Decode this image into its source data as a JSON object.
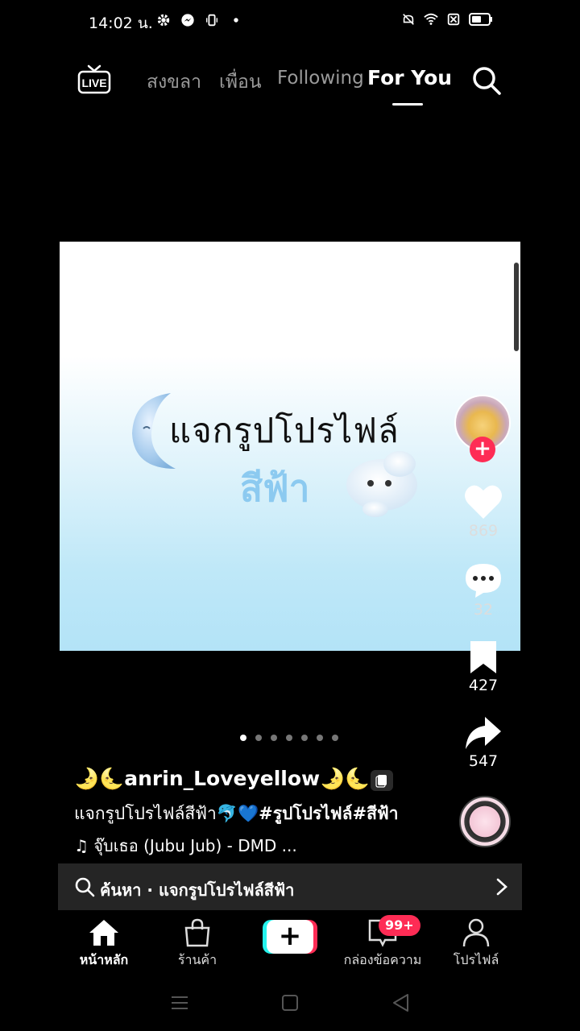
{
  "status_bar": {
    "time": "14:02 น."
  },
  "top_nav": {
    "live_label": "LIVE",
    "tabs": [
      {
        "label": "สงขลา"
      },
      {
        "label": "เพื่อน"
      },
      {
        "label": "Following"
      },
      {
        "label": "For You"
      }
    ],
    "active_tab": "For You"
  },
  "post": {
    "image_title_line1": "แจกรูปโปรไฟล์",
    "image_title_line2": "สีฟ้า",
    "carousel_total": 7,
    "carousel_active": 1,
    "author": "🌛🌜anrin_Loveyellow🌛🌜",
    "caption_text": "แจกรูปโปรไฟล์สีฟ้า🐬💙",
    "caption_tags": "#รูปโปรไฟล์#สีฟ้า",
    "music": "♫ จุ๊บเธอ (Jubu Jub) - DMD ..."
  },
  "actions": {
    "likes": "869",
    "comments": "32",
    "saves": "427",
    "shares": "547"
  },
  "search_suggestion": {
    "text": "ค้นหา · แจกรูปโปรไฟล์สีฟ้า"
  },
  "bottom_nav": {
    "home": "หน้าหลัก",
    "shop": "ร้านค้า",
    "inbox": "กล่องข้อความ",
    "inbox_badge": "99+",
    "profile": "โปรไฟล์"
  },
  "colors": {
    "accent_red": "#fe2c55",
    "accent_cyan": "#25f4ee",
    "title_blue": "#8ccaf0"
  }
}
